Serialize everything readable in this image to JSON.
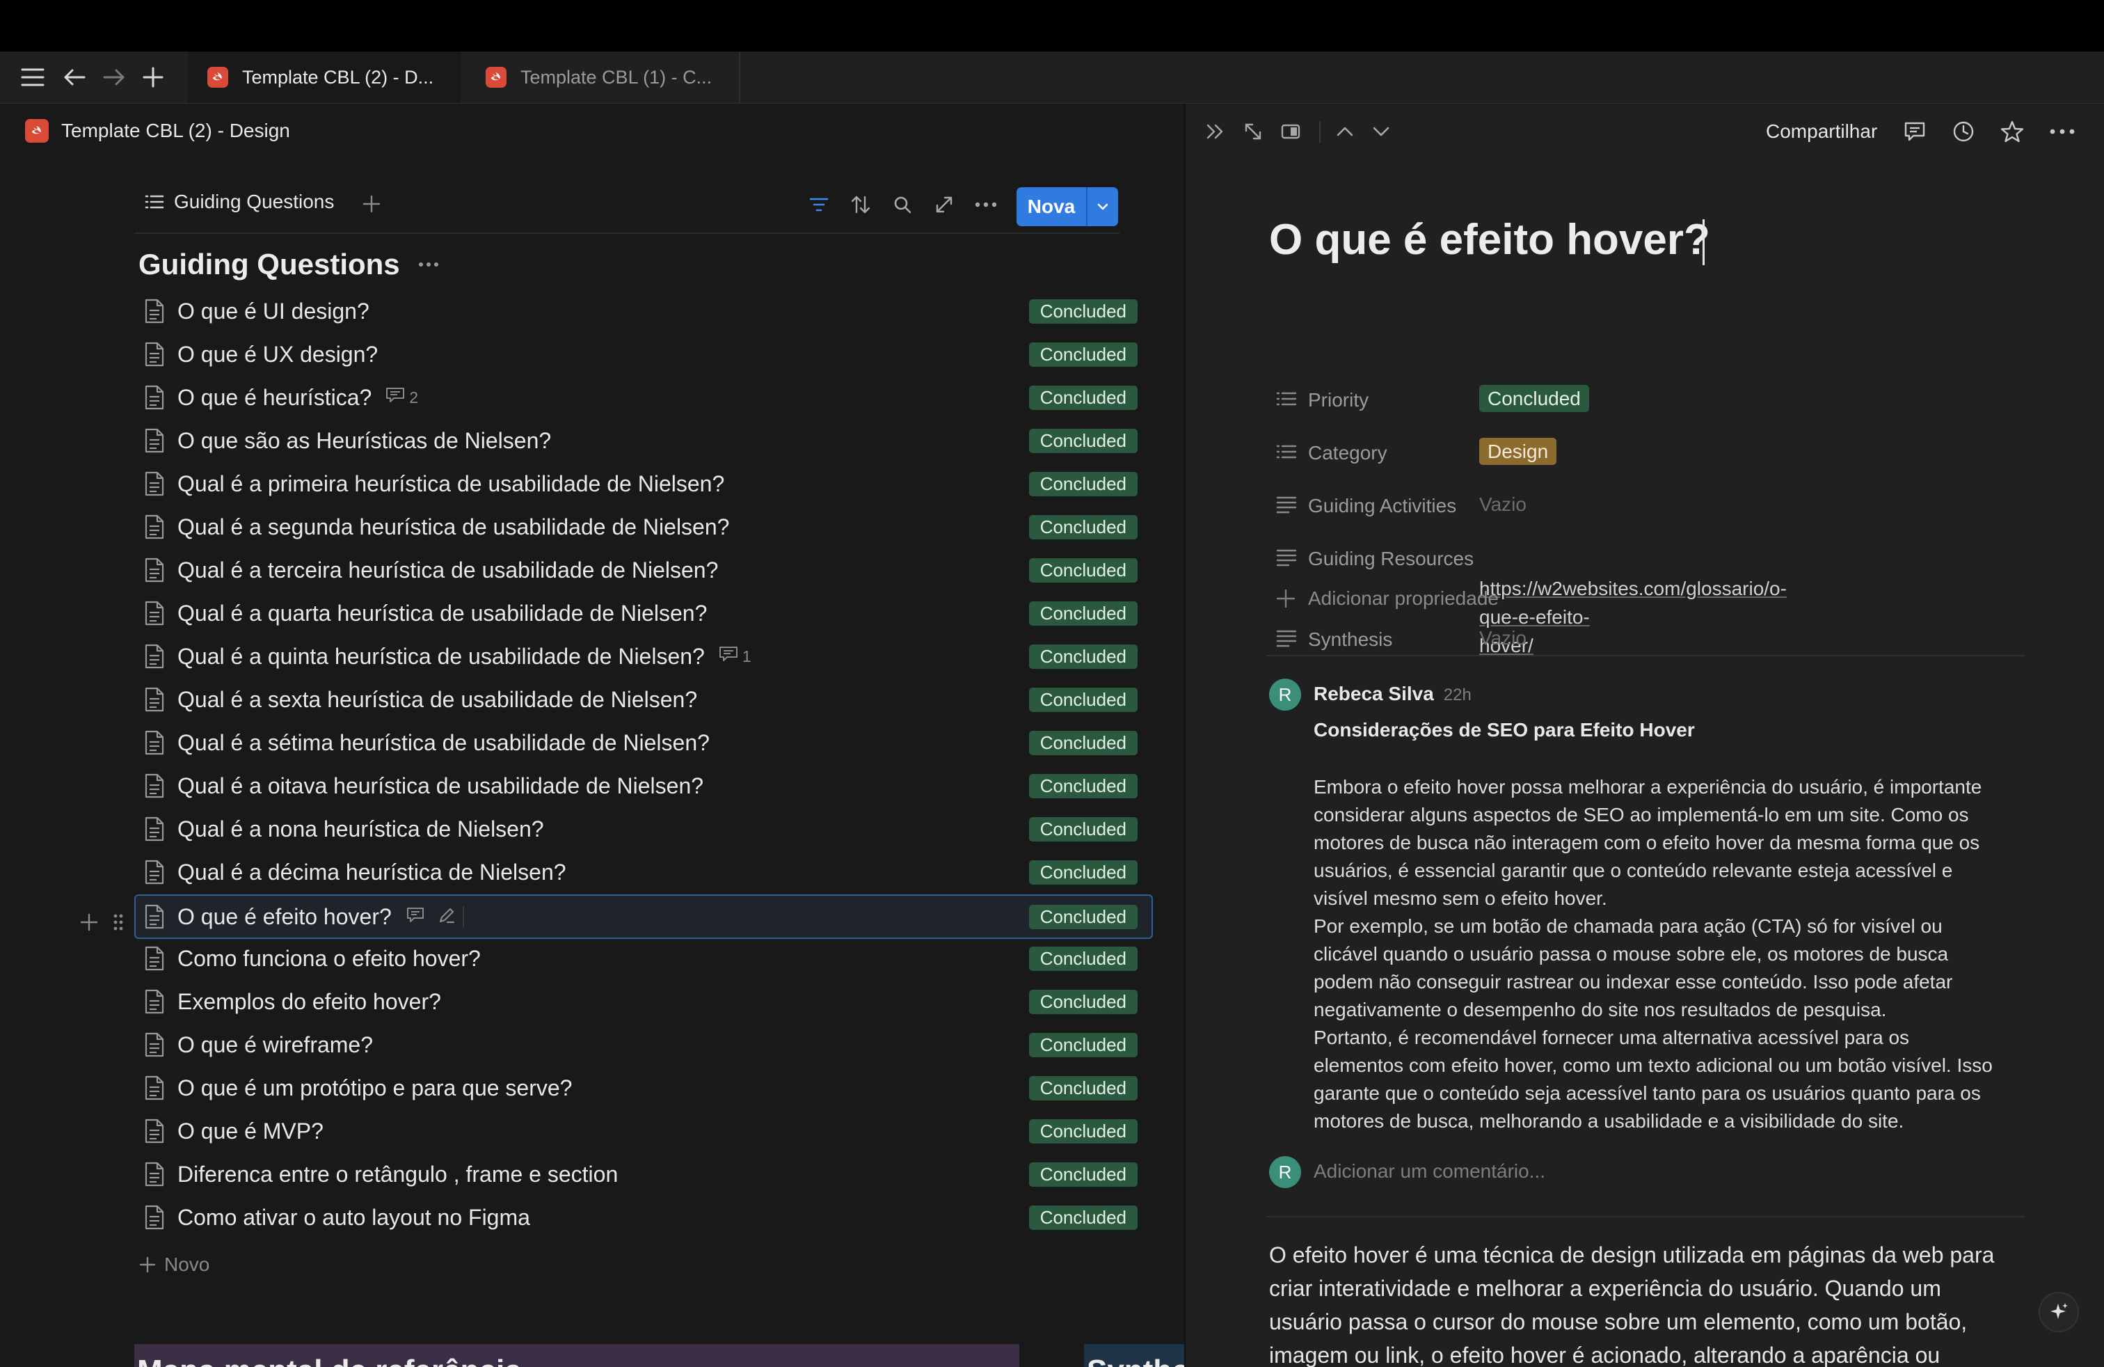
{
  "tabs": [
    {
      "label": "Template CBL (2) - D...",
      "active": true
    },
    {
      "label": "Template CBL (1) - C...",
      "active": false
    }
  ],
  "breadcrumb": {
    "title": "Template CBL (2) - Design"
  },
  "view": {
    "tab_label": "Guiding Questions",
    "new_button": "Nova",
    "heading": "Guiding Questions",
    "add_label": "Novo",
    "rows": [
      {
        "title": "O que é UI design?",
        "status": "Concluded",
        "comments": ""
      },
      {
        "title": "O que é UX design?",
        "status": "Concluded",
        "comments": ""
      },
      {
        "title": "O que é heurística?",
        "status": "Concluded",
        "comments": "2"
      },
      {
        "title": "O que são as Heurísticas de Nielsen?",
        "status": "Concluded",
        "comments": ""
      },
      {
        "title": "Qual é a primeira heurística de usabilidade de Nielsen?",
        "status": "Concluded",
        "comments": ""
      },
      {
        "title": "Qual é a segunda heurística de usabilidade de Nielsen?",
        "status": "Concluded",
        "comments": ""
      },
      {
        "title": "Qual é a terceira heurística de usabilidade de Nielsen?",
        "status": "Concluded",
        "comments": ""
      },
      {
        "title": "Qual é a quarta heurística de usabilidade de Nielsen?",
        "status": "Concluded",
        "comments": ""
      },
      {
        "title": "Qual é a quinta heurística de usabilidade de Nielsen?",
        "status": "Concluded",
        "comments": "1"
      },
      {
        "title": "Qual é a sexta heurística de usabilidade de Nielsen?",
        "status": "Concluded",
        "comments": ""
      },
      {
        "title": "Qual é a sétima heurística de usabilidade de Nielsen?",
        "status": "Concluded",
        "comments": ""
      },
      {
        "title": "Qual é a oitava heurística de usabilidade de Nielsen?",
        "status": "Concluded",
        "comments": ""
      },
      {
        "title": "Qual é a nona heurística de Nielsen?",
        "status": "Concluded",
        "comments": ""
      },
      {
        "title": "Qual é a décima heurística de Nielsen?",
        "status": "Concluded",
        "comments": ""
      },
      {
        "title": "O que é efeito hover?",
        "status": "Concluded",
        "comments": "",
        "selected": true
      },
      {
        "title": "Como funciona o efeito hover?",
        "status": "Concluded",
        "comments": ""
      },
      {
        "title": "Exemplos do efeito hover?",
        "status": "Concluded",
        "comments": ""
      },
      {
        "title": "O que é wireframe?",
        "status": "Concluded",
        "comments": ""
      },
      {
        "title": "O que é um protótipo e para que serve?",
        "status": "Concluded",
        "comments": ""
      },
      {
        "title": "O que é MVP?",
        "status": "Concluded",
        "comments": ""
      },
      {
        "title": "Diferenca entre o retângulo , frame e section",
        "status": "Concluded",
        "comments": ""
      },
      {
        "title": "Como ativar o auto layout no Figma",
        "status": "Concluded",
        "comments": ""
      }
    ],
    "bottom_block_left": "Mapa mental de referência",
    "bottom_block_right": "Synthe"
  },
  "detail": {
    "share_label": "Compartilhar",
    "title": "O que é efeito hover?",
    "properties": [
      {
        "label": "Priority",
        "value": "Concluded",
        "kind": "chip-green"
      },
      {
        "label": "Category",
        "value": "Design",
        "kind": "chip-orange"
      },
      {
        "label": "Guiding Activities",
        "value": "Vazio",
        "kind": "empty"
      },
      {
        "label": "Guiding Resources",
        "value": "https://w2websites.com/glossario/o-que-e-efeito-hover/",
        "value_line1": "https://w2websites.com/glossario/o-que-e-efeito-",
        "value_line2": "hover/",
        "kind": "link"
      },
      {
        "label": "Synthesis",
        "value": "Vazio",
        "kind": "empty"
      }
    ],
    "add_property": "Adicionar propriedade",
    "comment": {
      "avatar": "R",
      "author": "Rebeca Silva",
      "time": "22h",
      "heading": "Considerações de SEO para Efeito Hover",
      "lines": [
        "Embora o efeito hover possa melhorar a experiência do usuário, é importante",
        "considerar alguns aspectos de SEO ao implementá-lo em um site. Como os",
        "motores de busca não interagem com o efeito hover da mesma forma que os",
        "usuários, é essencial garantir que o conteúdo relevante esteja acessível e",
        "visível mesmo sem o efeito hover.",
        "Por exemplo, se um botão de chamada para ação (CTA) só for visível ou",
        "clicável quando o usuário passa o mouse sobre ele, os motores de busca",
        "podem não conseguir rastrear ou indexar esse conteúdo. Isso pode afetar",
        "negativamente o desempenho do site nos resultados de pesquisa.",
        "Portanto, é recomendável fornecer uma alternativa acessível para os",
        "elementos com efeito hover, como um texto adicional ou um botão visível. Isso",
        "garante que o conteúdo seja acessível tanto para os usuários quanto para os",
        "motores de busca, melhorando a usabilidade e a visibilidade do site."
      ]
    },
    "add_comment_placeholder": "Adicionar um comentário...",
    "body_lines": [
      "O efeito hover é uma técnica de design utilizada em páginas da web para",
      "criar interatividade e melhorar a experiência do usuário. Quando um",
      "usuário passa o cursor do mouse sobre um elemento, como um botão,",
      "imagem ou link, o efeito hover é acionado, alterando a aparência ou"
    ]
  },
  "colors": {
    "status_green": "#2b593f",
    "category_orange": "#8c6b2f",
    "primary_blue": "#2f7be0"
  }
}
